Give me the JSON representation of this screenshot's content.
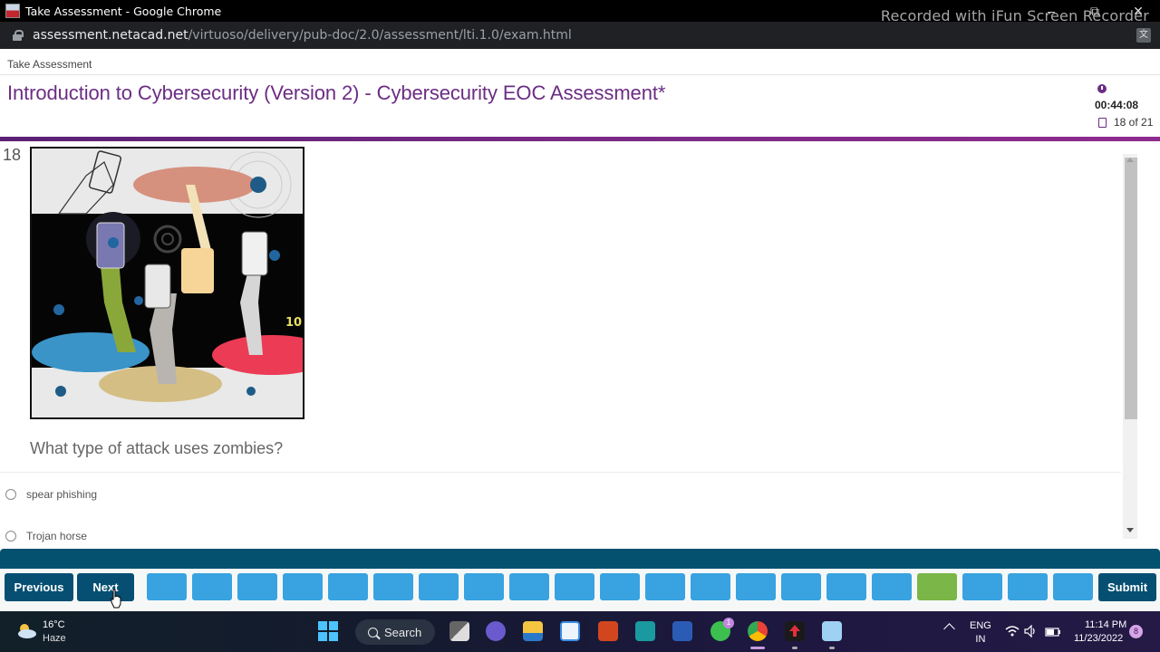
{
  "browser": {
    "window_title": "Take Assessment - Google Chrome",
    "url_host": "assessment.netacad.net",
    "url_path": "/virtuoso/delivery/pub-doc/2.0/assessment/lti.1.0/exam.html",
    "watermark": "Recorded with iFun Screen Recorder",
    "window_controls": {
      "minimize": "–",
      "restore": "⧉",
      "close": "✕"
    }
  },
  "page": {
    "breadcrumb": "Take Assessment",
    "title": "Introduction to Cybersecurity (Version 2) - Cybersecurity EOC Assessment*",
    "timer": "00:44:08",
    "progress_text": "18 of 21",
    "accent_color": "#6b2d83"
  },
  "question": {
    "number": "18",
    "image_alt": "Illustration of zombie hands rising from holes holding mobile phones",
    "text": "What type of attack uses zombies?",
    "options": [
      {
        "label": "spear phishing",
        "selected": false
      },
      {
        "label": "Trojan horse",
        "selected": false
      }
    ]
  },
  "navigation": {
    "previous_label": "Previous",
    "next_label": "Next",
    "submit_label": "Submit",
    "total_questions": 21,
    "current_question": 18,
    "box_color": "#38a3e0",
    "current_color": "#7ab648"
  },
  "taskbar": {
    "weather_temp": "16°C",
    "weather_desc": "Haze",
    "search_label": "Search",
    "apps": [
      {
        "name": "task-view",
        "badge": ""
      },
      {
        "name": "teams-meet",
        "badge": ""
      },
      {
        "name": "file-explorer",
        "badge": ""
      },
      {
        "name": "microsoft-store",
        "badge": ""
      },
      {
        "name": "powerpoint",
        "badge": ""
      },
      {
        "name": "arduino",
        "badge": ""
      },
      {
        "name": "word",
        "badge": ""
      },
      {
        "name": "whatsapp",
        "badge": "1"
      },
      {
        "name": "chrome",
        "badge": ""
      },
      {
        "name": "upload-app",
        "badge": ""
      },
      {
        "name": "notepad",
        "badge": ""
      }
    ],
    "lang_top": "ENG",
    "lang_bottom": "IN",
    "time": "11:14 PM",
    "date": "11/23/2022",
    "notification_count": "8"
  }
}
